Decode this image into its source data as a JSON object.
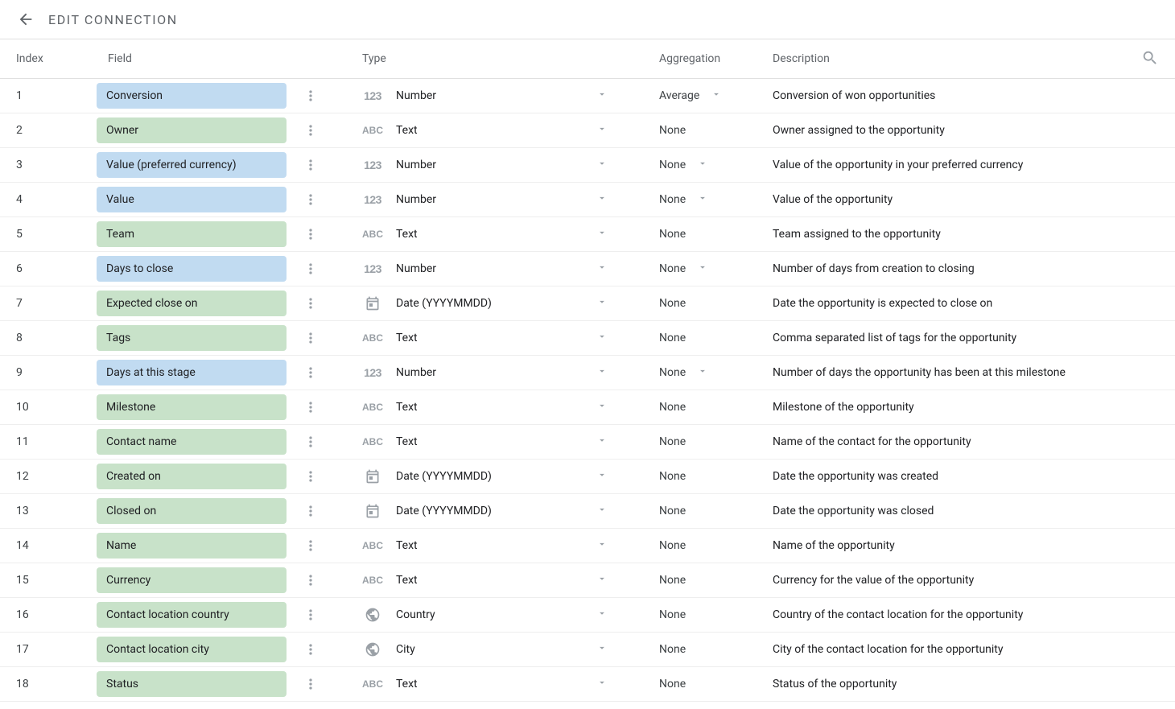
{
  "header": {
    "title": "EDIT CONNECTION"
  },
  "columns": {
    "index": "Index",
    "field": "Field",
    "type": "Type",
    "aggregation": "Aggregation",
    "description": "Description"
  },
  "rows": [
    {
      "index": "1",
      "field": "Conversion",
      "color": "blue",
      "typeIcon": "num",
      "type": "Number",
      "agg": "Average",
      "aggChevron": true,
      "desc": "Conversion of won opportunities"
    },
    {
      "index": "2",
      "field": "Owner",
      "color": "green",
      "typeIcon": "abc",
      "type": "Text",
      "agg": "None",
      "aggChevron": false,
      "desc": "Owner assigned to the opportunity"
    },
    {
      "index": "3",
      "field": "Value (preferred currency)",
      "color": "blue",
      "typeIcon": "num",
      "type": "Number",
      "agg": "None",
      "aggChevron": true,
      "desc": "Value of the opportunity in your preferred currency"
    },
    {
      "index": "4",
      "field": "Value",
      "color": "blue",
      "typeIcon": "num",
      "type": "Number",
      "agg": "None",
      "aggChevron": true,
      "desc": "Value of the opportunity"
    },
    {
      "index": "5",
      "field": "Team",
      "color": "green",
      "typeIcon": "abc",
      "type": "Text",
      "agg": "None",
      "aggChevron": false,
      "desc": "Team assigned to the opportunity"
    },
    {
      "index": "6",
      "field": "Days to close",
      "color": "blue",
      "typeIcon": "num",
      "type": "Number",
      "agg": "None",
      "aggChevron": true,
      "desc": "Number of days from creation to closing"
    },
    {
      "index": "7",
      "field": "Expected close on",
      "color": "green",
      "typeIcon": "date",
      "type": "Date (YYYYMMDD)",
      "agg": "None",
      "aggChevron": false,
      "desc": "Date the opportunity is expected to close on"
    },
    {
      "index": "8",
      "field": "Tags",
      "color": "green",
      "typeIcon": "abc",
      "type": "Text",
      "agg": "None",
      "aggChevron": false,
      "desc": "Comma separated list of tags for the opportunity"
    },
    {
      "index": "9",
      "field": "Days at this stage",
      "color": "blue",
      "typeIcon": "num",
      "type": "Number",
      "agg": "None",
      "aggChevron": true,
      "desc": "Number of days the opportunity has been at this milestone"
    },
    {
      "index": "10",
      "field": "Milestone",
      "color": "green",
      "typeIcon": "abc",
      "type": "Text",
      "agg": "None",
      "aggChevron": false,
      "desc": "Milestone of the opportunity"
    },
    {
      "index": "11",
      "field": "Contact name",
      "color": "green",
      "typeIcon": "abc",
      "type": "Text",
      "agg": "None",
      "aggChevron": false,
      "desc": "Name of the contact for the opportunity"
    },
    {
      "index": "12",
      "field": "Created on",
      "color": "green",
      "typeIcon": "date",
      "type": "Date (YYYYMMDD)",
      "agg": "None",
      "aggChevron": false,
      "desc": "Date the opportunity was created"
    },
    {
      "index": "13",
      "field": "Closed on",
      "color": "green",
      "typeIcon": "date",
      "type": "Date (YYYYMMDD)",
      "agg": "None",
      "aggChevron": false,
      "desc": "Date the opportunity was closed"
    },
    {
      "index": "14",
      "field": "Name",
      "color": "green",
      "typeIcon": "abc",
      "type": "Text",
      "agg": "None",
      "aggChevron": false,
      "desc": "Name of the opportunity"
    },
    {
      "index": "15",
      "field": "Currency",
      "color": "green",
      "typeIcon": "abc",
      "type": "Text",
      "agg": "None",
      "aggChevron": false,
      "desc": "Currency for the value of the opportunity"
    },
    {
      "index": "16",
      "field": "Contact location country",
      "color": "green",
      "typeIcon": "globe",
      "type": "Country",
      "agg": "None",
      "aggChevron": false,
      "desc": "Country of the contact location for the opportunity"
    },
    {
      "index": "17",
      "field": "Contact location city",
      "color": "green",
      "typeIcon": "globe",
      "type": "City",
      "agg": "None",
      "aggChevron": false,
      "desc": "City of the contact location for the opportunity"
    },
    {
      "index": "18",
      "field": "Status",
      "color": "green",
      "typeIcon": "abc",
      "type": "Text",
      "agg": "None",
      "aggChevron": false,
      "desc": "Status of the opportunity"
    }
  ]
}
